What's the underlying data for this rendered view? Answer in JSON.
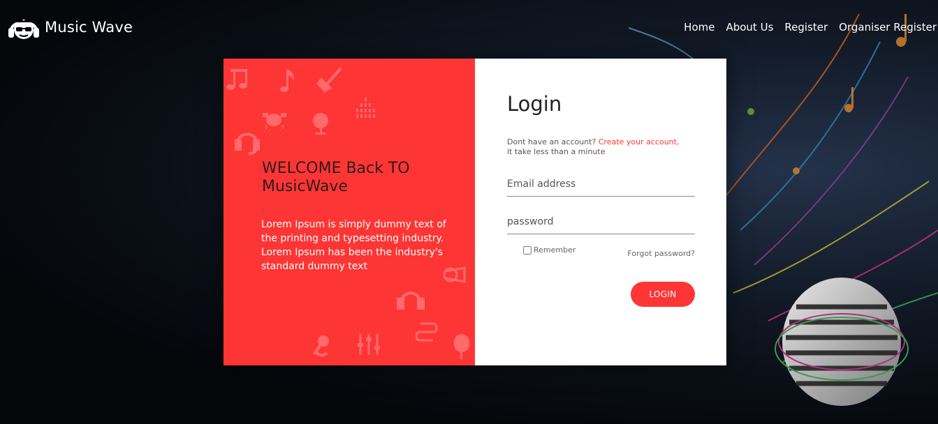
{
  "brand": {
    "name": "Music Wave",
    "logo_icon": "headphones-face-logo"
  },
  "nav": {
    "items": [
      {
        "label": "Home"
      },
      {
        "label": "About Us"
      },
      {
        "label": "Register"
      },
      {
        "label": "Organiser Register"
      }
    ]
  },
  "welcome": {
    "title": "WELCOME Back TO MusicWave",
    "text": "Lorem Ipsum is simply dummy text of the printing and typesetting industry. Lorem Ipsum has been the industry's standard dummy text"
  },
  "login": {
    "title": "Login",
    "account_prompt": "Dont have an account?",
    "create_link": "Create your account,",
    "account_suffix": "it take less than a minute",
    "email_placeholder": "Email address",
    "password_placeholder": "password",
    "remember_label": "Remember",
    "forgot_label": "Forgot password?",
    "button_label": "LOGIN"
  },
  "colors": {
    "accent": "#fe3535",
    "background": "#0b0f16",
    "card_right": "#ffffff",
    "title_text": "#2b1b1b"
  }
}
